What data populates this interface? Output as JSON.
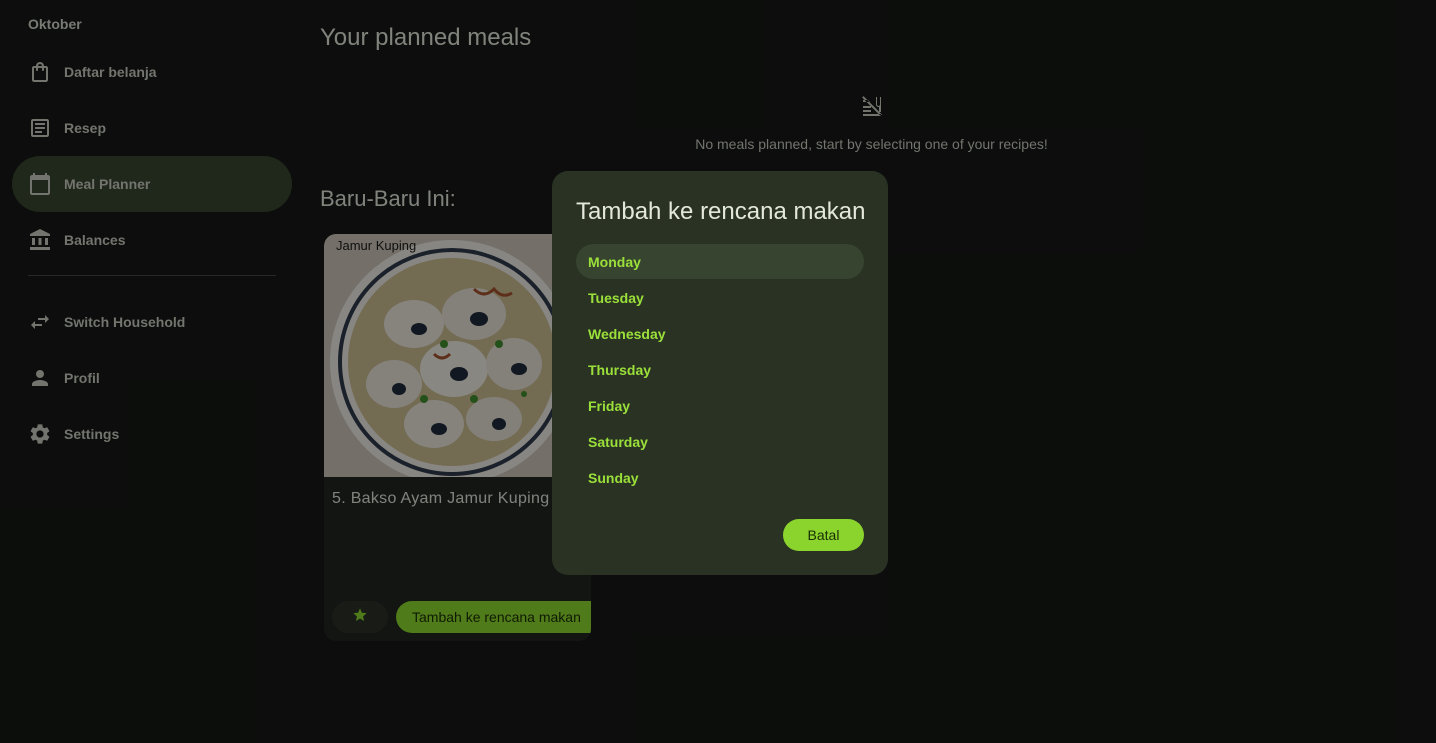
{
  "sidebar": {
    "household_name": "Oktober",
    "items": [
      {
        "label": "Daftar belanja",
        "icon": "shopping-bag-icon"
      },
      {
        "label": "Resep",
        "icon": "receipt-icon"
      },
      {
        "label": "Meal Planner",
        "icon": "calendar-icon",
        "active": true
      },
      {
        "label": "Balances",
        "icon": "bank-icon"
      },
      {
        "label": "Switch Household",
        "icon": "swap-icon"
      },
      {
        "label": "Profil",
        "icon": "person-icon"
      },
      {
        "label": "Settings",
        "icon": "gear-icon"
      }
    ]
  },
  "main": {
    "title": "Your planned meals",
    "empty_message": "No meals planned, start by selecting one of your recipes!",
    "recent_title": "Baru-Baru Ini:",
    "recipe": {
      "image_caption": "Jamur Kuping",
      "name": "5. Bakso Ayam Jamur Kuping",
      "add_button": "Tambah ke rencana makan"
    }
  },
  "dialog": {
    "title": "Tambah ke rencana makan",
    "days": [
      "Monday",
      "Tuesday",
      "Wednesday",
      "Thursday",
      "Friday",
      "Saturday",
      "Sunday"
    ],
    "cancel_label": "Batal"
  },
  "colors": {
    "accent": "#8bd42e",
    "background": "#151815",
    "dialog": "#2a3323"
  }
}
